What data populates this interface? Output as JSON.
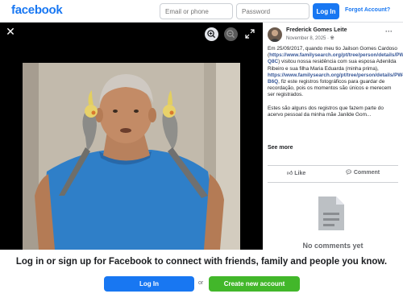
{
  "topbar": {
    "logo": "facebook",
    "email_placeholder": "Email or phone",
    "password_placeholder": "Password",
    "login_label": "Log In",
    "forgot_label": "Forgot Account?"
  },
  "viewer": {
    "close_icon": "close-icon",
    "zoom_in_icon": "zoom-in-icon",
    "zoom_out_icon": "zoom-out-icon",
    "fullscreen_icon": "fullscreen-icon"
  },
  "post": {
    "author": "Frederick Gomes Leite",
    "date": "November 8, 2025",
    "date_separator": "·",
    "text_1": "Em 25/09/2017, quando meu tio Jailson Gomes Cardoso (",
    "link_1": "https://www.familysearch.org/pt/tree/person/details/PWQJ-Q8C",
    "text_2": ") visitou nossa residência com sua esposa Adenilda Ribeiro e sua filha Maria Eduarda (minha prima), ",
    "link_2": "https://www.familysearch.org/pt/tree/person/details/PW4G-B6Q",
    "text_3": ", fiz este registros fotográficos para guardar de recordação, pois os momentos são únicos e merecem ser registrados.",
    "text_4": "Estes são alguns dos registros que fazem parte do acervo pessoal da minha mãe Janilde Gom...",
    "see_more": "See more",
    "like_label": "Like",
    "comment_label": "Comment",
    "no_comments": "No comments yet"
  },
  "bottom": {
    "title": "Log in or sign up for Facebook to connect with friends, family and people you know.",
    "login_label": "Log In",
    "or_label": "or",
    "create_label": "Create new account"
  },
  "colors": {
    "brand": "#1877f2",
    "create": "#42b72a",
    "link": "#385898"
  }
}
